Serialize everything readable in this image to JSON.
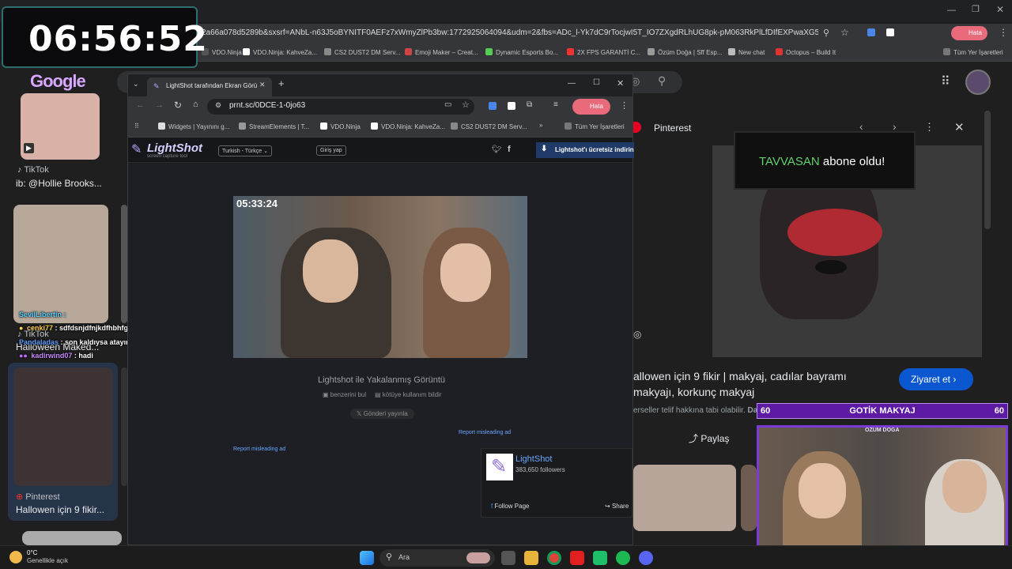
{
  "timer": {
    "value": "06:56:52"
  },
  "back_browser": {
    "url": "2a66a078d5289b&sxsrf=ANbL-n63J5oBYNITF0AEFz7xWmyZlPb3bw:1772925064094&udm=2&fbs=ADc_l-Yk7dC9rTocjwI5T_IO7ZXgdRLhUG8pk-pM063RkPlLfDIfEXPwaXG5eHwO7qyO_m",
    "bookmarks": [
      "VDO.Ninja",
      "VDO.Ninja: KahveZa...",
      "CS2 DUST2 DM Serv...",
      "Emoji Maker – Creat...",
      "Dynamic Esports Bo...",
      "2X FPS GARANTİ C...",
      "Özüm Doğa | Sff Esp...",
      "New chat",
      "Octopus – Build It"
    ],
    "all_bookmarks": "Tüm Yer İşaretleri",
    "profile": "Hata"
  },
  "google": {
    "logo": "Google",
    "results": [
      {
        "source": "TikTok",
        "title": "ib: @Hollie Brooks..."
      },
      {
        "source": "TikTok",
        "title": "Halloween Maked..."
      },
      {
        "source": "Pinterest",
        "title": "Hallowen için 9 fikir..."
      }
    ]
  },
  "chat_overlay": [
    {
      "user": "SevilLibertin",
      "msg": ":"
    },
    {
      "user": "cenki77",
      "msg": ": sdfdsnjdfnjkdfhbhfgf"
    },
    {
      "user": "Pandaladas",
      "msg": ": son kaldıysa atayım"
    },
    {
      "user": "kadirwind07",
      "msg": ": hadi"
    }
  ],
  "front_browser": {
    "tab_title": "LightShot tarafından Ekran Görü",
    "url": "prnt.sc/0DCE-1-0jo63",
    "profile": "Hata",
    "bookmarks": [
      "Widgets | Yayınını g...",
      "StreamElements | T...",
      "VDO.Ninja",
      "VDO.Ninja: KahveZa...",
      "CS2 DUST2 DM Serv..."
    ],
    "all_bookmarks": "Tüm Yer İşaretleri"
  },
  "lightshot": {
    "logo": "LightShot",
    "tagline": "screen capture tool",
    "language": "Turkish - Türkçe",
    "login": "Giriş yap",
    "download": "Lightshot'ı ücretsiz indirin",
    "shot_timer": "05:33:24",
    "caption": "Lightshot ile Yakalanmış Görüntü",
    "similar": "benzerini bul",
    "report_abuse": "kötüye kullanım bildir",
    "tweet": "Gönderi yayınla",
    "report_ad_1": "Report misleading ad",
    "report_ad_2": "Report misleading ad",
    "fb_name": "LightShot",
    "fb_followers": "383,650 followers",
    "fb_follow": "Follow Page",
    "fb_share": "Share"
  },
  "right_panel": {
    "source": "Pinterest",
    "title_line1": "allowen için 9 fikir | makyaj, cadılar bayramı",
    "title_line2": "makyajı, korkunç makyaj",
    "copyright": "erseller telif hakkına tabi olabilir.",
    "more": "Daha",
    "visit": "Ziyaret et",
    "share": "Paylaş"
  },
  "alert": {
    "user": "TAVVASAN",
    "text": "abone oldu!"
  },
  "gotik_bar": {
    "title": "GOTİK MAKYAJ",
    "left_num": "60",
    "right_num": "60",
    "cam_label": "ÖZÜM DOĞA"
  },
  "taskbar": {
    "weather_temp": "0°C",
    "weather_desc": "Genellikle açık",
    "search": "Ara"
  }
}
